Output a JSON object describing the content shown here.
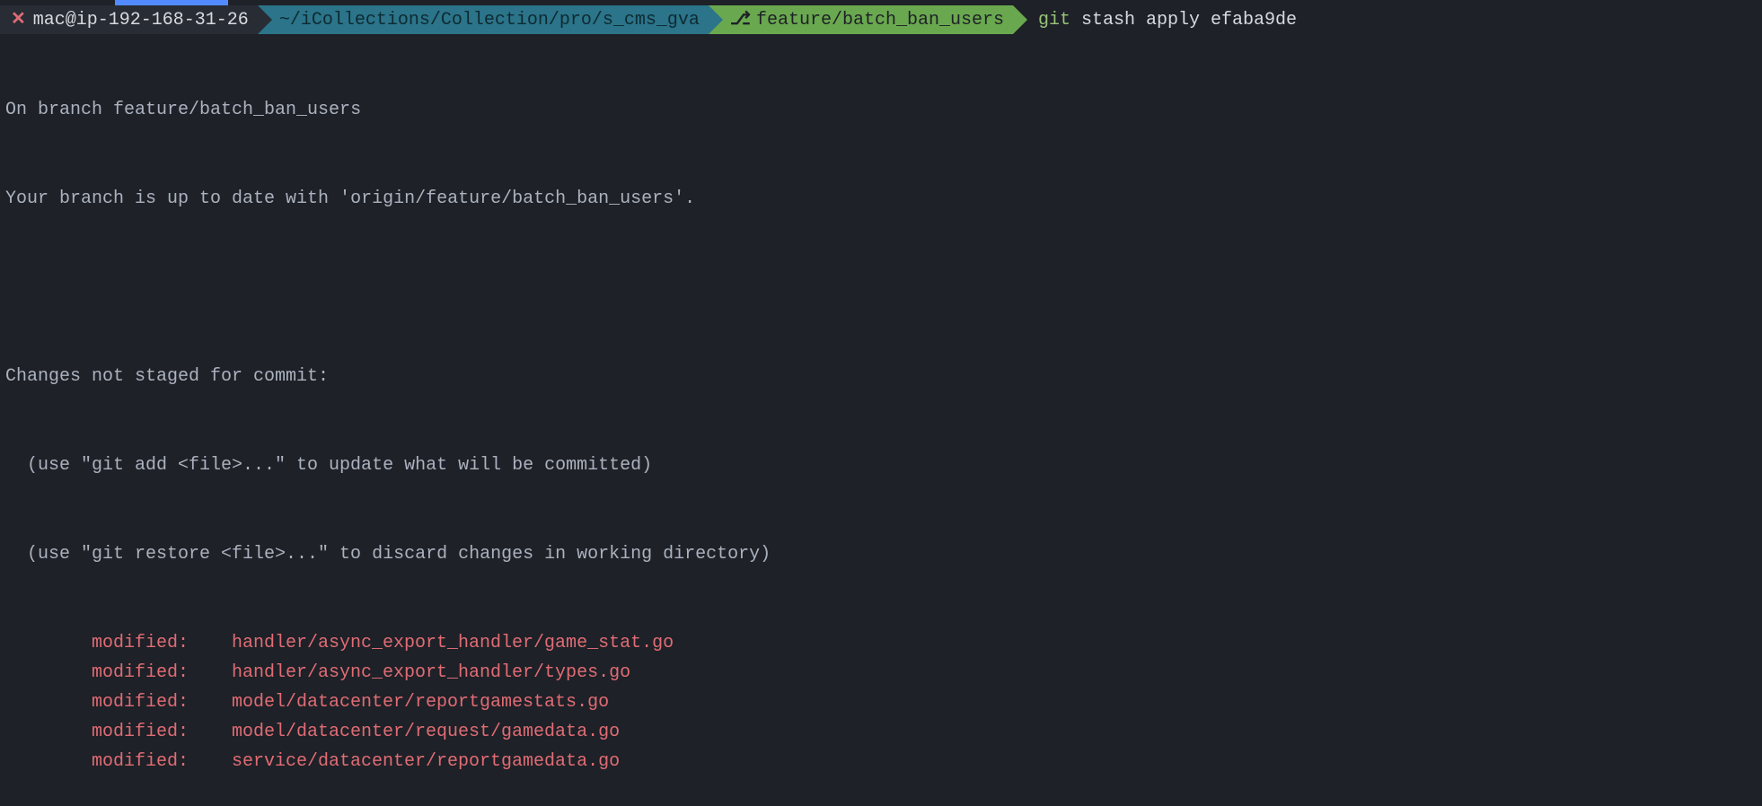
{
  "prompt": {
    "close_symbol": "✕",
    "user_host": "mac@ip-192-168-31-26",
    "path": "~/iCollections/Collection/pro/s_cms_gva",
    "branch_icon": "⎇",
    "branch": "feature/batch_ban_users",
    "git_command": "git",
    "git_args": " stash apply efaba9de"
  },
  "output": {
    "line1": "On branch feature/batch_ban_users",
    "line2": "Your branch is up to date with 'origin/feature/batch_ban_users'.",
    "blank": "",
    "line3": "Changes not staged for commit:",
    "hint1": "(use \"git add <file>...\" to update what will be committed)",
    "hint2": "(use \"git restore <file>...\" to discard changes in working directory)",
    "modified_label": "modified:",
    "files": [
      "handler/async_export_handler/game_stat.go",
      "handler/async_export_handler/types.go",
      "model/datacenter/reportgamestats.go",
      "model/datacenter/request/gamedata.go",
      "service/datacenter/reportgamedata.go"
    ]
  }
}
